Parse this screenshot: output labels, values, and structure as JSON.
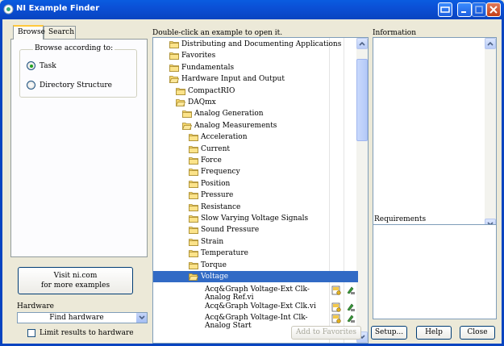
{
  "window": {
    "title": "NI Example Finder"
  },
  "tabs": [
    {
      "label": "Browse",
      "active": true
    },
    {
      "label": "Search",
      "active": false
    }
  ],
  "browse": {
    "group_label": "Browse according to:",
    "options": [
      {
        "label": "Task",
        "checked": true
      },
      {
        "label": "Directory Structure",
        "checked": false
      }
    ]
  },
  "visit": {
    "line1": "Visit ni.com",
    "line2": "for more examples"
  },
  "hardware": {
    "label": "Hardware",
    "selected": "Find hardware",
    "limit_label": "Limit results to hardware"
  },
  "tree": {
    "heading": "Double-click an example to open it.",
    "rows": [
      {
        "label": "Distributing and Documenting Applications",
        "depth": 0,
        "type": "folder"
      },
      {
        "label": "Favorites",
        "depth": 0,
        "type": "folder"
      },
      {
        "label": "Fundamentals",
        "depth": 0,
        "type": "folder"
      },
      {
        "label": "Hardware Input and Output",
        "depth": 0,
        "type": "folder-open"
      },
      {
        "label": "CompactRIO",
        "depth": 1,
        "type": "folder"
      },
      {
        "label": "DAQmx",
        "depth": 1,
        "type": "folder-open"
      },
      {
        "label": "Analog Generation",
        "depth": 2,
        "type": "folder"
      },
      {
        "label": "Analog Measurements",
        "depth": 2,
        "type": "folder-open"
      },
      {
        "label": "Acceleration",
        "depth": 3,
        "type": "folder"
      },
      {
        "label": "Current",
        "depth": 3,
        "type": "folder"
      },
      {
        "label": "Force",
        "depth": 3,
        "type": "folder"
      },
      {
        "label": "Frequency",
        "depth": 3,
        "type": "folder"
      },
      {
        "label": "Position",
        "depth": 3,
        "type": "folder"
      },
      {
        "label": "Pressure",
        "depth": 3,
        "type": "folder"
      },
      {
        "label": "Resistance",
        "depth": 3,
        "type": "folder"
      },
      {
        "label": "Slow Varying Voltage Signals",
        "depth": 3,
        "type": "folder"
      },
      {
        "label": "Sound Pressure",
        "depth": 3,
        "type": "folder"
      },
      {
        "label": "Strain",
        "depth": 3,
        "type": "folder"
      },
      {
        "label": "Temperature",
        "depth": 3,
        "type": "folder"
      },
      {
        "label": "Torque",
        "depth": 3,
        "type": "folder"
      },
      {
        "label": "Voltage",
        "depth": 3,
        "type": "folder-open",
        "selected": true
      }
    ],
    "vis": [
      {
        "label": "Acq&Graph Voltage-Ext Clk-Analog Ref.vi"
      },
      {
        "label": "Acq&Graph Voltage-Ext Clk.vi"
      },
      {
        "label": "Acq&Graph Voltage-Int Clk-Analog Start"
      }
    ]
  },
  "information": {
    "heading": "Information"
  },
  "requirements": {
    "heading": "Requirements"
  },
  "buttons": {
    "add_favorites": "Add to Favorites",
    "setup": "Setup...",
    "help": "Help",
    "close": "Close"
  },
  "colors": {
    "titlebar": "#0a5ce0",
    "selection": "#316ac5"
  }
}
